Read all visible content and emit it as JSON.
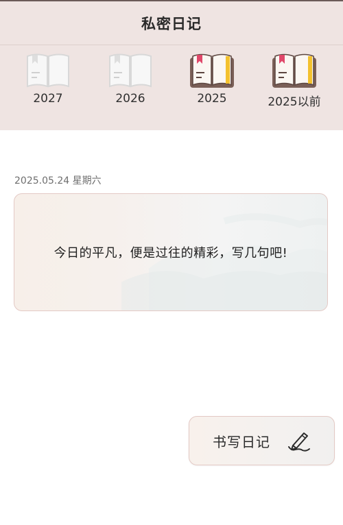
{
  "header": {
    "title": "私密日记"
  },
  "years": [
    {
      "label": "2027",
      "active": false
    },
    {
      "label": "2026",
      "active": false
    },
    {
      "label": "2025",
      "active": true
    },
    {
      "label": "2025以前",
      "active": true
    }
  ],
  "entry": {
    "date": "2025.05.24 星期六",
    "prompt": "今日的平凡，便是过往的精彩，写几句吧!"
  },
  "write_button": {
    "label": "书写日记",
    "icon": "pen-icon"
  },
  "colors": {
    "header_bg": "#efe4e2",
    "card_border": "#e3c9c4",
    "book_active_cover": "#7a5f57",
    "book_active_spine": "#f3c12e",
    "bookmark": "#e0486a"
  }
}
